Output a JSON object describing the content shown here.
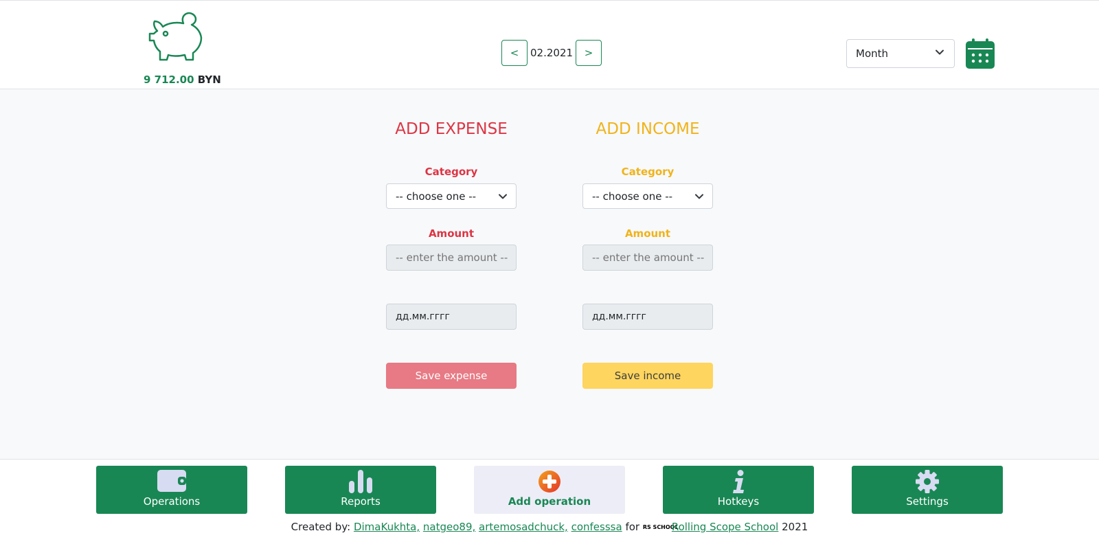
{
  "header": {
    "balance_amount": "9 712.00",
    "balance_currency": "BYN",
    "prev_label": "<",
    "next_label": ">",
    "current_period": "02.2021",
    "period_select": "Month",
    "logo_icon": "piggy-bank-icon",
    "calendar_icon": "calendar-icon"
  },
  "expense": {
    "title": "ADD EXPENSE",
    "category_label": "Category",
    "category_value": "-- choose one --",
    "amount_label": "Amount",
    "amount_placeholder": "-- enter the amount --",
    "date_placeholder": "дд.мм.гггг",
    "save_label": "Save expense"
  },
  "income": {
    "title": "ADD INCOME",
    "category_label": "Category",
    "category_value": "-- choose one --",
    "amount_label": "Amount",
    "amount_placeholder": "-- enter the amount --",
    "date_placeholder": "дд.мм.гггг",
    "save_label": "Save income"
  },
  "nav": [
    {
      "label": "Operations",
      "icon": "wallet-icon"
    },
    {
      "label": "Reports",
      "icon": "bar-chart-icon"
    },
    {
      "label": "Add operation",
      "icon": "plus-circle-icon"
    },
    {
      "label": "Hotkeys",
      "icon": "info-icon"
    },
    {
      "label": "Settings",
      "icon": "gear-icon"
    }
  ],
  "footer": {
    "created_by": "Created by:",
    "authors": [
      "DimaKukhta,",
      "natgeo89,",
      "artemosadchuck,",
      "confesssa"
    ],
    "for_text": "for",
    "school_logo_text": "RS SCHOOL",
    "school_link": "Rolling Scope School",
    "year": "2021"
  },
  "colors": {
    "brand": "#198754",
    "expense": "#dc3545",
    "income": "#f0b31b",
    "save_expense_bg": "#e77a84",
    "save_income_bg": "#fdd55f"
  }
}
